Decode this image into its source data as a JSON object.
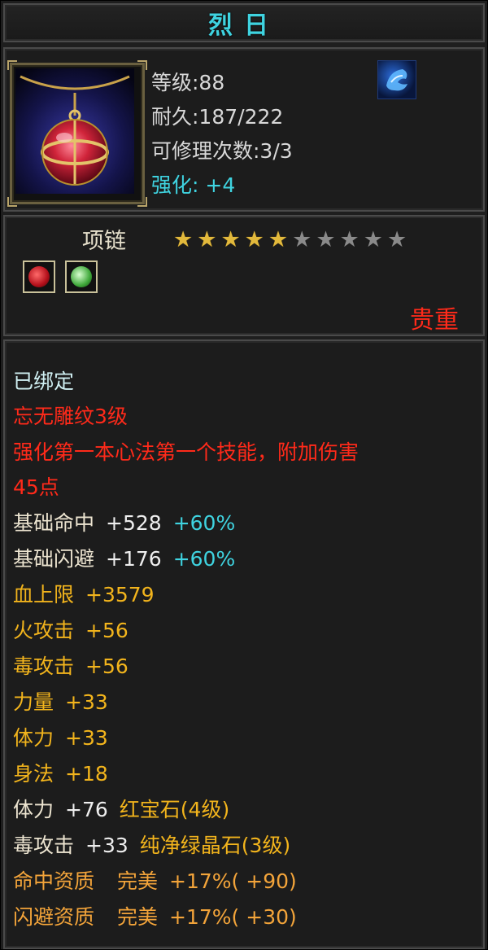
{
  "item": {
    "name": "烈日",
    "level": "等级:88",
    "durability": "耐久:187/222",
    "repairs": "可修理次数:3/3",
    "enhance": "强化: +4",
    "type": "项链",
    "stars_filled": 5,
    "stars_total": 10,
    "rarity": "贵重",
    "icons": {
      "item": "red-orb-necklace-icon",
      "skill": "blue-dragon-skill-icon",
      "gem1": "red-gem-icon",
      "gem2": "green-gem-icon"
    }
  },
  "props": {
    "bound": "已绑定",
    "engrave": "忘无雕纹3级",
    "effect_line1": "强化第一本心法第一个技能，附加伤害",
    "effect_line2": "45点",
    "stats": [
      {
        "label": "基础命中",
        "value": "+528",
        "extra": "+60%"
      },
      {
        "label": "基础闪避",
        "value": "+176",
        "extra": "+60%"
      },
      {
        "label": "血上限",
        "value": "+3579"
      },
      {
        "label": "火攻击",
        "value": "+56"
      },
      {
        "label": "毒攻击",
        "value": "+56"
      },
      {
        "label": "力量",
        "value": "+33"
      },
      {
        "label": "体力",
        "value": "+33"
      },
      {
        "label": "身法",
        "value": "+18"
      }
    ],
    "gem_stats": [
      {
        "label": "体力",
        "value": "+76",
        "gem": "红宝石(4级)"
      },
      {
        "label": "毒攻击",
        "value": "+33",
        "gem": "纯净绿晶石(3级)"
      }
    ],
    "qualities": [
      {
        "label": "命中资质",
        "grade": "完美",
        "value": "+17%",
        "bonus": "( +90)"
      },
      {
        "label": "闪避资质",
        "grade": "完美",
        "value": "+17%",
        "bonus": "( +30)"
      }
    ]
  },
  "colors": {
    "title": "#3fd3e0",
    "rarity": "#ff2a1a",
    "stat_gold": "#f2b41c",
    "quality_orange": "#f3a43a"
  }
}
